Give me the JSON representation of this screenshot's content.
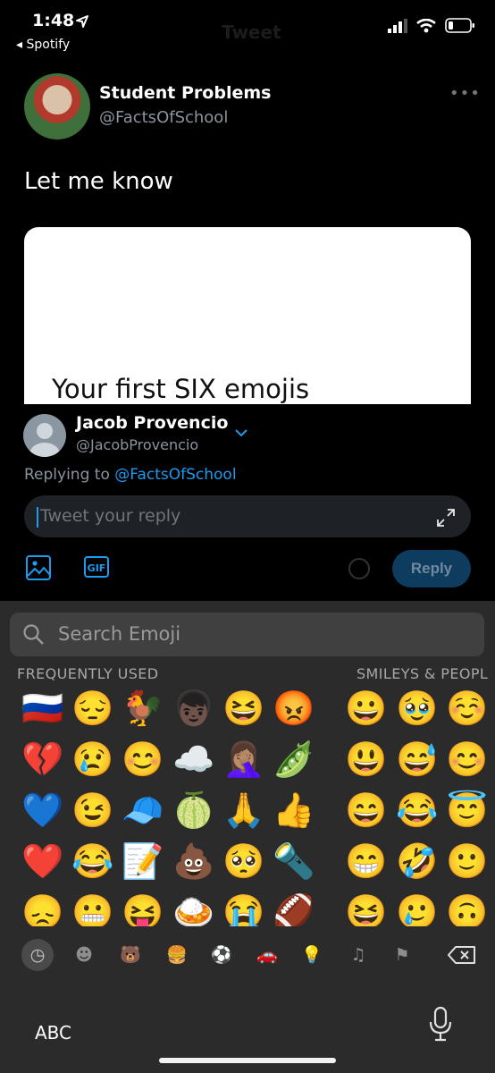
{
  "status_bar": {
    "time": "1:48",
    "back_app": "◂ Spotify",
    "title": "Tweet"
  },
  "tweet": {
    "author_name": "Student Problems",
    "author_handle": "@FactsOfSchool",
    "more": "•••",
    "text": "Let me know",
    "media_text": "Your first SIX emojis"
  },
  "composer": {
    "user_name": "Jacob Provencio",
    "user_handle": "@JacobProvencio",
    "replying_prefix": "Replying to",
    "replying_handle": "@FactsOfSchool",
    "placeholder": "Tweet your reply",
    "gif_label": "GIF",
    "reply_button": "Reply",
    "accent_color": "#1d9bf0"
  },
  "emoji_keyboard": {
    "search_placeholder": "Search Emoji",
    "section_frequent": "FREQUENTLY USED",
    "section_smileys": "SMILEYS & PEOPL",
    "emojis": [
      "🇷🇺",
      "😔",
      "🐓",
      "👦🏿",
      "😆",
      "😡",
      "💔",
      "😢",
      "😊",
      "☁️",
      "🤦🏽‍♀️",
      "🫛",
      "💙",
      "😉",
      "🧢",
      "🍈",
      "🙏",
      "👍",
      "❤️",
      "😂",
      "📝",
      "💩",
      "🥺",
      "🔦",
      "😞",
      "😬",
      "😝",
      "🍛",
      "😭",
      "🏈",
      "😀",
      "🥹",
      "☺️",
      "😃",
      "😅",
      "😊",
      "😄",
      "😂",
      "😇",
      "😁",
      "🤣",
      "🙂",
      "😆",
      "🥲",
      "🙃"
    ],
    "categories": [
      "recent-icon",
      "smiley-icon",
      "animal-icon",
      "food-icon",
      "activity-icon",
      "travel-icon",
      "objects-icon",
      "symbols-icon",
      "flags-icon"
    ],
    "abc_label": "ABC"
  }
}
